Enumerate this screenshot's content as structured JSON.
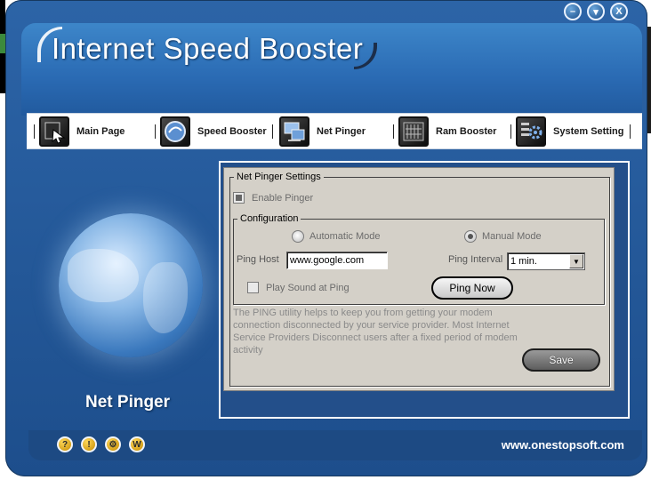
{
  "app": {
    "title": "Internet Speed Booster"
  },
  "window_controls": {
    "minimize_symbol": "–",
    "restore_symbol": "▾",
    "close_symbol": "X"
  },
  "toolbar": {
    "items": [
      {
        "label": "Main Page",
        "icon": "main-page-icon"
      },
      {
        "label": "Speed Booster",
        "icon": "speed-booster-icon"
      },
      {
        "label": "Net Pinger",
        "icon": "net-pinger-icon"
      },
      {
        "label": "Ram Booster",
        "icon": "ram-booster-icon"
      },
      {
        "label": "System Setting",
        "icon": "system-setting-icon"
      }
    ]
  },
  "left_panel": {
    "caption": "Net Pinger",
    "image": "globe"
  },
  "pinger": {
    "group_title": "Net Pinger Settings",
    "enable_label": "Enable Pinger",
    "enable_checked": true,
    "config_title": "Configuration",
    "mode_auto_label": "Automatic Mode",
    "mode_manual_label": "Manual Mode",
    "selected_mode": "Manual Mode",
    "ping_host_label": "Ping Host",
    "ping_host_value": "www.google.com",
    "ping_interval_label": "Ping Interval",
    "ping_interval_value": "1 min.",
    "play_sound_label": "Play Sound at Ping",
    "play_sound_checked": false,
    "ping_now_label": "Ping Now",
    "info": "The PING utility helps to keep you from getting your modem connection disconnected by your service provider. Most Internet Service Providers Disconnect users after a fixed period of modem activity",
    "save_label": "Save"
  },
  "footer": {
    "icons": [
      {
        "symbol": "?",
        "name": "help-icon"
      },
      {
        "symbol": "!",
        "name": "info-icon"
      },
      {
        "symbol": "⚙",
        "name": "settings-icon"
      },
      {
        "symbol": "W",
        "name": "web-icon"
      }
    ],
    "url": "www.onestopsoft.com"
  },
  "colors": {
    "app_blue": "#2c64a7",
    "panel_gray": "#d4d0c8",
    "text_white": "#ffffff"
  }
}
